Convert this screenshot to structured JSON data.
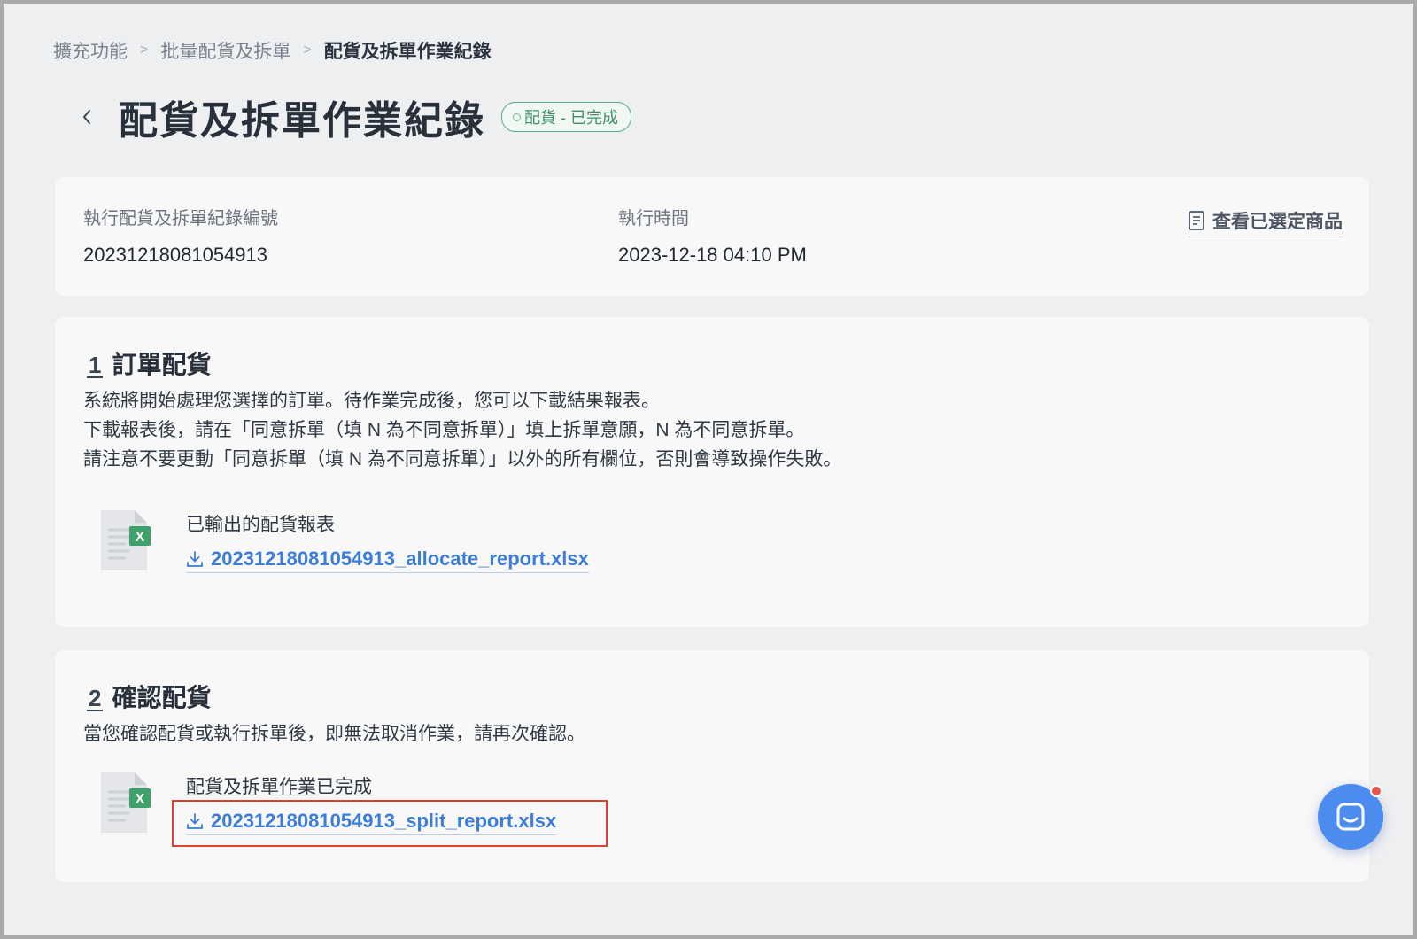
{
  "breadcrumb": {
    "items": [
      "擴充功能",
      "批量配貨及拆單"
    ],
    "current": "配貨及拆單作業紀錄",
    "separator": ">"
  },
  "header": {
    "title": "配貨及拆單作業紀錄",
    "status": "配貨 - 已完成",
    "back_icon": "chevron-left-icon"
  },
  "info": {
    "record_label": "執行配貨及拆單紀錄編號",
    "record_value": "20231218081054913",
    "time_label": "執行時間",
    "time_value": "2023-12-18 04:10 PM",
    "view_products": "查看已選定商品"
  },
  "step1": {
    "number": "1",
    "title": "訂單配貨",
    "desc": [
      "系統將開始處理您選擇的訂單。待作業完成後，您可以下載結果報表。",
      "下載報表後，請在「同意拆單（填 N 為不同意拆單）」填上拆單意願，N 為不同意拆單。",
      "請注意不要更動「同意拆單（填 N 為不同意拆單）」以外的所有欄位，否則會導致操作失敗。"
    ],
    "file_label": "已輸出的配貨報表",
    "file_name": "20231218081054913_allocate_report.xlsx"
  },
  "step2": {
    "number": "2",
    "title": "確認配貨",
    "desc": [
      "當您確認配貨或執行拆單後，即無法取消作業，請再次確認。"
    ],
    "file_label": "配貨及拆單作業已完成",
    "file_name": "20231218081054913_split_report.xlsx"
  },
  "colors": {
    "accent": "#3b7dd8",
    "status_green": "#3f8f6b",
    "highlight": "#d9432f",
    "chat": "#4b8cee"
  }
}
